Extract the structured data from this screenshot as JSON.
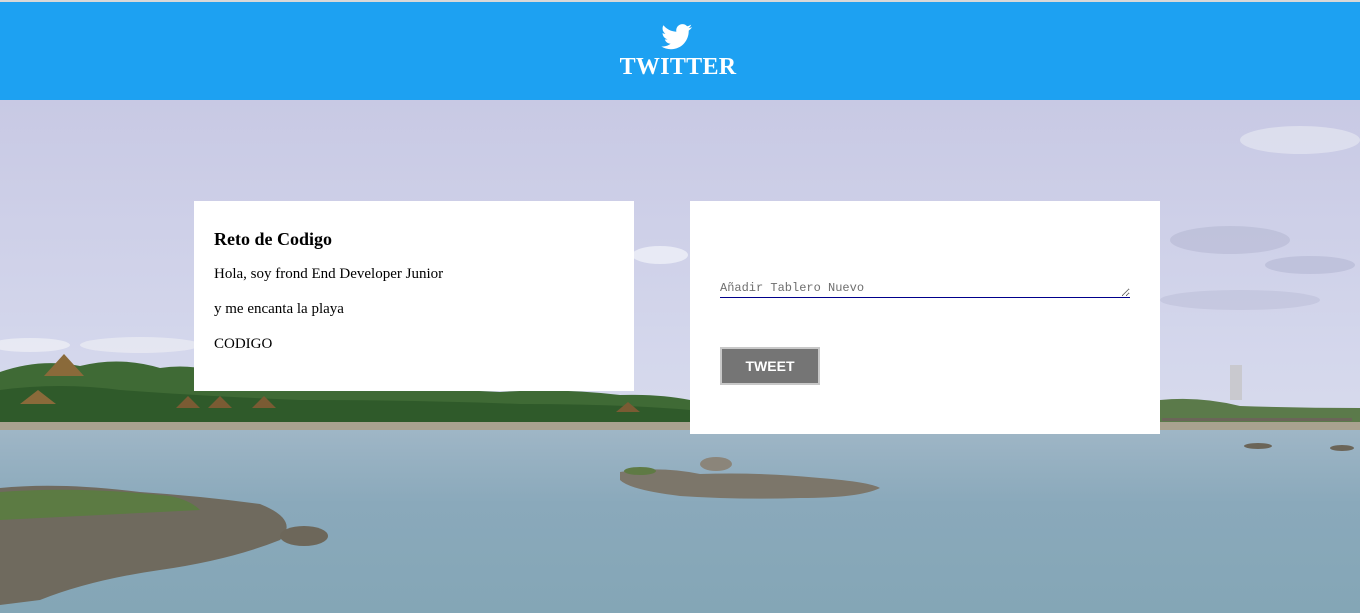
{
  "header": {
    "brand": "TWITTER",
    "logo_icon": "twitter-bird-icon",
    "background_color": "#1da1f2"
  },
  "profile_card": {
    "title": "Reto de Codigo",
    "lines": [
      "Hola, soy frond End Developer Junior",
      "y me encanta la playa",
      "CODIGO"
    ]
  },
  "tweet_card": {
    "input_value": "",
    "input_placeholder": "Añadir Tablero Nuevo",
    "button_label": "TWEET",
    "button_color": "#757575"
  },
  "background": {
    "description_icon": "beach-lagoon-photo"
  }
}
